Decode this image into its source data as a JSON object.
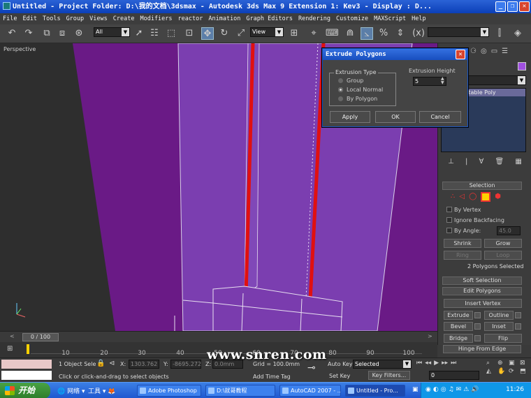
{
  "window": {
    "title": "Untitled      - Project Folder: D:\\我的文档\\3dsmax      - Autodesk 3ds Max 9 Extension 1: Kev3      - Display : D...",
    "min_icon": "minimize-icon",
    "max_icon": "maximize-icon",
    "close_icon": "close-icon"
  },
  "menu": [
    "File",
    "Edit",
    "Tools",
    "Group",
    "Views",
    "Create",
    "Modifiers",
    "reactor",
    "Animation",
    "Graph Editors",
    "Rendering",
    "Customize",
    "MAXScript",
    "Help"
  ],
  "toolbar": {
    "selection_filter": "All",
    "reference_coord": "View",
    "named_selection": ""
  },
  "viewport": {
    "label": "Perspective",
    "colors": {
      "background": "#6a1a86",
      "object": "#7b3eb0",
      "edge_selected": "#e01010",
      "wire": "#d8d0e8"
    }
  },
  "dialog": {
    "title": "Extrude Polygons",
    "group_label": "Extrusion Type",
    "options": [
      "Group",
      "Local Normal",
      "By Polygon"
    ],
    "selected": "Local Normal",
    "height_label": "Extrusion Height",
    "height_value": "5",
    "apply": "Apply",
    "ok": "OK",
    "cancel": "Cancel"
  },
  "command_panel": {
    "modifier_item": "Editable Poly",
    "selection_header": "Selection",
    "by_vertex": "By Vertex",
    "ignore_backfacing": "Ignore Backfacing",
    "by_angle": "By Angle:",
    "by_angle_value": "45.0",
    "shrink": "Shrink",
    "grow": "Grow",
    "ring": "Ring",
    "loop": "Loop",
    "selected_info": "2 Polygons Selected",
    "soft_selection": "Soft Selection",
    "edit_polygons": "Edit Polygons",
    "insert_vertex": "Insert Vertex",
    "extrude": "Extrude",
    "outline": "Outline",
    "bevel": "Bevel",
    "inset": "Inset",
    "bridge": "Bridge",
    "flip": "Flip",
    "hinge": "Hinge From Edge"
  },
  "timeline": {
    "frame": "0 / 100",
    "ticks": [
      "10",
      "20",
      "30",
      "40",
      "50",
      "60",
      "70",
      "80",
      "90",
      "100"
    ]
  },
  "status": {
    "selection": "1 Object Sele",
    "prompt": "Click or click-and-drag to select objects",
    "x_label": "X:",
    "x_value": "1303.762",
    "y_label": "Y:",
    "y_value": "-8695.272",
    "z_label": "Z:",
    "z_value": "0.0mm",
    "grid": "Grid = 100.0mm",
    "add_time_tag": "Add Time Tag",
    "auto_key": "Auto Key",
    "set_key": "Set Key",
    "key_mode": "Selected",
    "key_filters": "Key Filters...",
    "current_frame": "0"
  },
  "watermark": "www.snren.com",
  "taskbar": {
    "start": "开始",
    "quick": [
      "网络",
      "工具"
    ],
    "tasks": [
      "Adobe Photoshop",
      "D:\\就哥教程",
      "AutoCAD 2007 - ...",
      "Untitled    - Pro..."
    ],
    "clock": "11:26"
  }
}
